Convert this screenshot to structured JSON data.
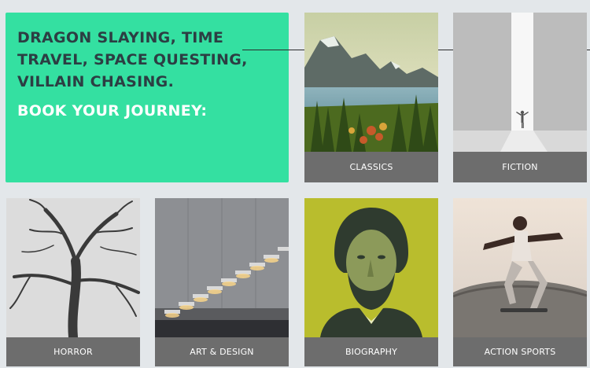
{
  "hero": {
    "headline": "DRAGON SLAYING, TIME TRAVEL, SPACE QUESTING, VILLAIN CHASING.",
    "cta": "BOOK YOUR JOURNEY:"
  },
  "categories": [
    {
      "label": "CLASSICS",
      "image": "mountain-lake-photo"
    },
    {
      "label": "FICTION",
      "image": "light-door-photo"
    },
    {
      "label": "HORROR",
      "image": "bare-tree-photo"
    },
    {
      "label": "ART & DESIGN",
      "image": "lit-staircase-photo"
    },
    {
      "label": "BIOGRAPHY",
      "image": "lincoln-portrait-photo"
    },
    {
      "label": "ACTION SPORTS",
      "image": "skateboarder-photo"
    }
  ],
  "colors": {
    "hero_background": "#34e0a1",
    "hero_headline": "#2c3e43",
    "hero_cta": "#ffffff",
    "label_background": "#6d6d6d",
    "page_background": "#e3e7ea"
  }
}
